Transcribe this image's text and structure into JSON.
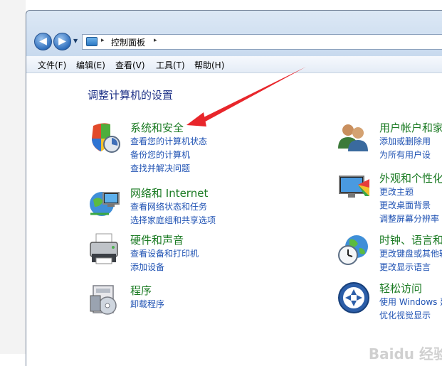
{
  "nav": {
    "back_glyph": "◀",
    "forward_glyph": "▶",
    "address_segment": "控制面板",
    "separator": "▸",
    "dropdown_glyph": "▼"
  },
  "menu": [
    {
      "label": "文件(F)"
    },
    {
      "label": "编辑(E)"
    },
    {
      "label": "查看(V)"
    },
    {
      "label": "工具(T)"
    },
    {
      "label": "帮助(H)"
    }
  ],
  "page_title": "调整计算机的设置",
  "left_categories": [
    {
      "icon": "shield-icon",
      "title": "系统和安全",
      "links": [
        "查看您的计算机状态",
        "备份您的计算机",
        "查找并解决问题"
      ]
    },
    {
      "icon": "network-icon",
      "title": "网络和 Internet",
      "links": [
        "查看网络状态和任务",
        "选择家庭组和共享选项"
      ]
    },
    {
      "icon": "printer-icon",
      "title": "硬件和声音",
      "links": [
        "查看设备和打印机",
        "添加设备"
      ]
    },
    {
      "icon": "programs-icon",
      "title": "程序",
      "links": [
        "卸载程序"
      ]
    }
  ],
  "right_categories": [
    {
      "icon": "users-icon",
      "title": "用户帐户和家",
      "links": [
        "添加或删除用",
        "为所有用户设"
      ]
    },
    {
      "icon": "appearance-icon",
      "title": "外观和个性化",
      "links": [
        "更改主题",
        "更改桌面背景",
        "调整屏幕分辨率"
      ]
    },
    {
      "icon": "globe-clock-icon",
      "title": "时钟、语言和",
      "links": [
        "更改键盘或其他输",
        "更改显示语言"
      ]
    },
    {
      "icon": "accessibility-icon",
      "title": "轻松访问",
      "links": [
        "使用 Windows 建",
        "优化视觉显示"
      ]
    }
  ],
  "watermark": "Baidu 经验",
  "colors": {
    "category_title": "#1a7a22",
    "link": "#1f52b3",
    "page_title": "#1e3287",
    "annotation_arrow": "#e8262b"
  }
}
